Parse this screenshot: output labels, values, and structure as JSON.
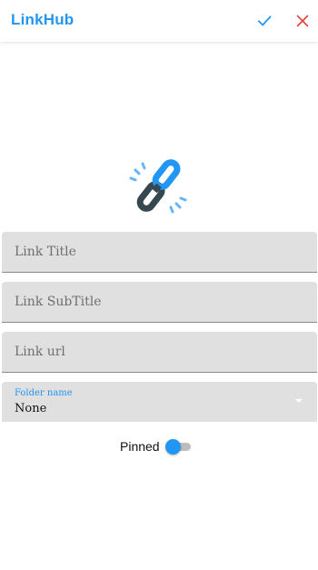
{
  "appbar": {
    "title": "LinkHub",
    "confirm_icon": "check-icon",
    "cancel_icon": "close-icon"
  },
  "colors": {
    "accent": "#2196F3",
    "cancel": "#E53935",
    "field_bg": "#E0E0E0"
  },
  "logo": {
    "icon": "chain-link-icon"
  },
  "form": {
    "link_title": {
      "value": "",
      "placeholder": "Link Title"
    },
    "link_subtitle": {
      "value": "",
      "placeholder": "Link SubTitle"
    },
    "link_url": {
      "value": "",
      "placeholder": "Link url"
    },
    "folder": {
      "label": "Folder name",
      "selected": "None",
      "icon": "dropdown-arrow-icon"
    },
    "pinned": {
      "label": "Pinned",
      "on": false
    }
  }
}
